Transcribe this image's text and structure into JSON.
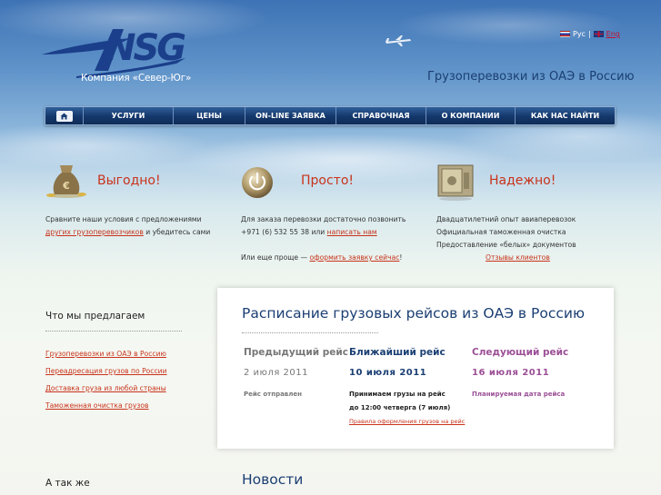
{
  "header": {
    "company_caption": "Компания «Север-Юг»",
    "tagline": "Грузоперевозки из ОАЭ в Россию",
    "lang_ru": "Рус",
    "lang_sep": "|",
    "lang_en": "Eng"
  },
  "nav": {
    "items": [
      "УСЛУГИ",
      "ЦЕНЫ",
      "ON-LINE ЗАЯВКА",
      "СПРАВОЧНАЯ",
      "О КОМПАНИИ",
      "КАК НАС НАЙТИ"
    ]
  },
  "features": {
    "profit": {
      "title": "Выгодно!",
      "text1": "Сравните наши условия с предложениями",
      "link": "других грузоперевозчиков",
      "text2": " и убедитесь сами"
    },
    "simple": {
      "title": "Просто!",
      "text1": "Для заказа перевозки достаточно позвонить",
      "phone": "+971 (6) 532 55 38 или ",
      "link": "написать нам",
      "text2": "Или еще проще — ",
      "link2": "оформить заявку сейчас",
      "text3": "!"
    },
    "reliable": {
      "title": "Надежно!",
      "line1": "Двадцатилетний опыт авиаперевозок",
      "line2": "Официальная таможенная очистка",
      "line3": "Предоставление «белых» документов",
      "link": "Отзывы клиентов"
    }
  },
  "sidebar": {
    "offer_title": "Что мы предлагаем",
    "links": [
      "Грузоперевозки из ОАЭ в Россию",
      "Переадресация грузов по России",
      "Доставка груза из любой страны",
      "Таможенная очистка грузов"
    ],
    "also_title": "А так же"
  },
  "schedule": {
    "title": "Расписание грузовых рейсов из ОАЭ в Россию",
    "prev": {
      "heading": "Предыдущий рейс",
      "date": "2  июля  2011",
      "status": "Рейс отправлен"
    },
    "next": {
      "heading": "Ближайший рейс",
      "date": "10  июля  2011",
      "status1": "Принимаем грузы на рейс",
      "status2": "до 12:00 четверга (7 июля)",
      "link": "Правила оформления грузов на рейс"
    },
    "following": {
      "heading": "Следующий рейс",
      "date": "16  июля  2011",
      "status": "Планируемая дата рейса"
    }
  },
  "news": {
    "title": "Новости"
  },
  "colors": {
    "brand_blue": "#1b3f73",
    "accent_red": "#c8331b",
    "purple": "#9b4f96",
    "grey": "#777777"
  }
}
